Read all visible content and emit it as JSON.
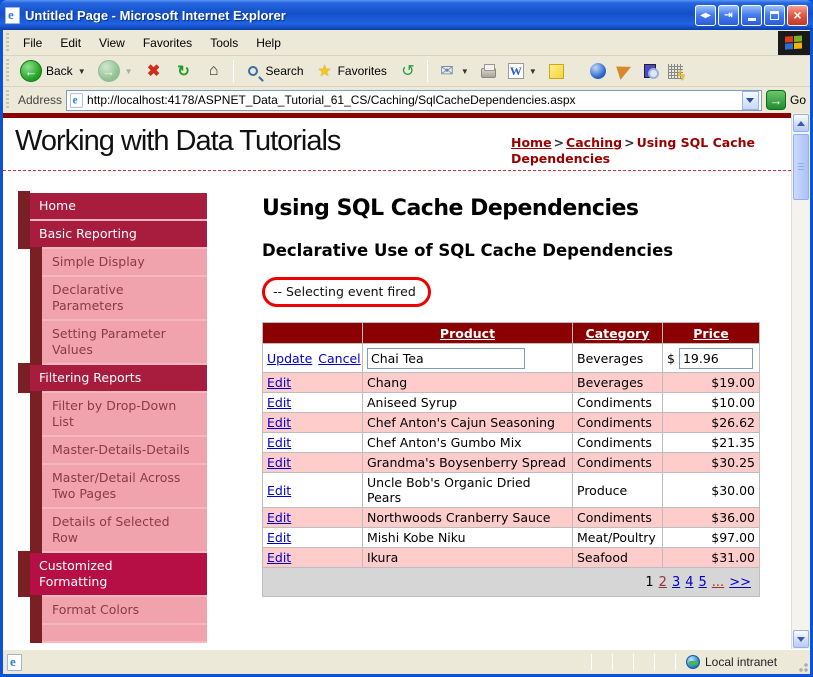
{
  "colors": {
    "titlebar_blue": "#1450c8",
    "chrome_beige": "#ece9d8",
    "page_maroon": "#8b0000",
    "sidebar_section_bg": "#a81c3e",
    "sidebar_section_highlight_bg": "#b60f46",
    "sidebar_stripe": "#7a2025",
    "sidebar_sub_bg": "#f1a3ad",
    "sidebar_sub_text": "#8b3a44",
    "row_pink": "#ffcccc",
    "pager_gray": "#d6d6d6",
    "link_blue": "#0000cc",
    "visited_link_red": "#993333",
    "breadcrumb_red": "#990000",
    "annotation_red": "#ee0000"
  },
  "window": {
    "title": "Untitled Page - Microsoft Internet Explorer"
  },
  "menu": {
    "items": [
      "File",
      "Edit",
      "View",
      "Favorites",
      "Tools",
      "Help"
    ]
  },
  "toolbar": {
    "back": "Back",
    "search": "Search",
    "favorites": "Favorites"
  },
  "address": {
    "label": "Address",
    "url": "http://localhost:4178/ASPNET_Data_Tutorial_61_CS/Caching/SqlCacheDependencies.aspx",
    "go": "Go"
  },
  "header": {
    "site_title": "Working with Data Tutorials",
    "breadcrumb": {
      "link1": "Home",
      "link2": "Caching",
      "separator": ">",
      "current": "Using SQL Cache Dependencies"
    }
  },
  "sidebar": {
    "items": [
      {
        "label": "Home"
      },
      {
        "label": "Basic Reporting"
      },
      {
        "label": "Simple Display"
      },
      {
        "label": "Declarative Parameters"
      },
      {
        "label": "Setting Parameter Values"
      },
      {
        "label": "Filtering Reports"
      },
      {
        "label": "Filter by Drop-Down List"
      },
      {
        "label": "Master-Details-Details"
      },
      {
        "label": "Master/Detail Across Two Pages"
      },
      {
        "label": "Details of Selected Row"
      },
      {
        "label": "Customized Formatting"
      },
      {
        "label": "Format Colors"
      }
    ]
  },
  "content": {
    "heading": "Using SQL Cache Dependencies",
    "subheading": "Declarative Use of SQL Cache Dependencies",
    "event_message": "-- Selecting event fired"
  },
  "grid": {
    "headers": {
      "product": "Product",
      "category": "Category",
      "price": "Price"
    },
    "edit_label": "Edit",
    "edit_row": {
      "update": "Update",
      "cancel": "Cancel",
      "product_value": "Chai Tea",
      "category": "Beverages",
      "currency": "$",
      "price_value": "19.96"
    },
    "rows": [
      {
        "product": "Chang",
        "category": "Beverages",
        "price": "$19.00"
      },
      {
        "product": "Aniseed Syrup",
        "category": "Condiments",
        "price": "$10.00"
      },
      {
        "product": "Chef Anton's Cajun Seasoning",
        "category": "Condiments",
        "price": "$26.62"
      },
      {
        "product": "Chef Anton's Gumbo Mix",
        "category": "Condiments",
        "price": "$21.35"
      },
      {
        "product": "Grandma's Boysenberry Spread",
        "category": "Condiments",
        "price": "$30.25"
      },
      {
        "product": "Uncle Bob's Organic Dried Pears",
        "category": "Produce",
        "price": "$30.00"
      },
      {
        "product": "Northwoods Cranberry Sauce",
        "category": "Condiments",
        "price": "$36.00"
      },
      {
        "product": "Mishi Kobe Niku",
        "category": "Meat/Poultry",
        "price": "$97.00"
      },
      {
        "product": "Ikura",
        "category": "Seafood",
        "price": "$31.00"
      }
    ],
    "pager": {
      "current": "1",
      "page2": "2",
      "page3": "3",
      "page4": "4",
      "page5": "5",
      "ellipsis": "...",
      "next": ">>"
    }
  },
  "statusbar": {
    "zone": "Local intranet"
  }
}
